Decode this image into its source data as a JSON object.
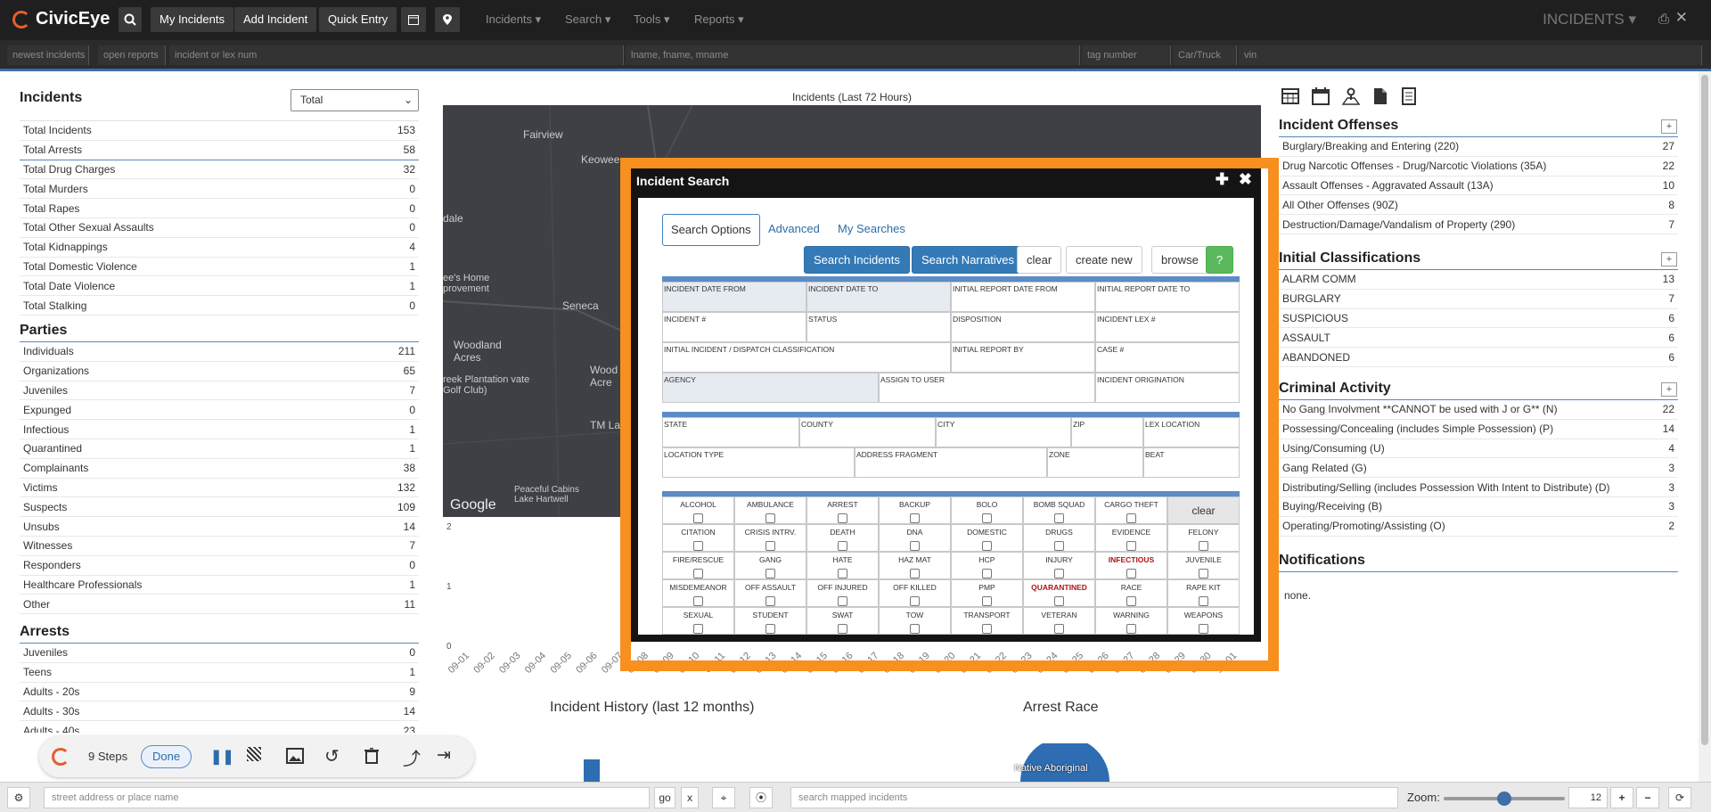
{
  "app": {
    "logo": "CivicEye",
    "nav_buttons": [
      "My Incidents",
      "Add Incident",
      "Quick Entry"
    ],
    "menus": [
      "Incidents",
      "Search",
      "Tools",
      "Reports"
    ],
    "page_title": "INCIDENTS"
  },
  "searchbar": {
    "newest": "newest incidents",
    "open": "open reports",
    "incident_placeholder": "incident or lex num",
    "name_placeholder": "lname, fname, mname",
    "tag_placeholder": "tag number",
    "car_placeholder": "Car/Truck",
    "vin_placeholder": "vin"
  },
  "incidents": {
    "title": "Incidents",
    "select": "Total",
    "rows": [
      {
        "label": "Total Incidents",
        "value": "153"
      },
      {
        "label": "Total Arrests",
        "value": "58"
      },
      {
        "label": "Total Drug Charges",
        "value": "32"
      },
      {
        "label": "Total Murders",
        "value": "0"
      },
      {
        "label": "Total Rapes",
        "value": "0"
      },
      {
        "label": "Total Other Sexual Assaults",
        "value": "0"
      },
      {
        "label": "Total Kidnappings",
        "value": "4"
      },
      {
        "label": "Total Domestic Violence",
        "value": "1"
      },
      {
        "label": "Total Date Violence",
        "value": "1"
      },
      {
        "label": "Total Stalking",
        "value": "0"
      }
    ]
  },
  "parties": {
    "title": "Parties",
    "rows": [
      {
        "label": "Individuals",
        "value": "211"
      },
      {
        "label": "Organizations",
        "value": "65"
      },
      {
        "label": "Juveniles",
        "value": "7"
      },
      {
        "label": "Expunged",
        "value": "0"
      },
      {
        "label": "Infectious",
        "value": "1"
      },
      {
        "label": "Quarantined",
        "value": "1"
      },
      {
        "label": "Complainants",
        "value": "38"
      },
      {
        "label": "Victims",
        "value": "132"
      },
      {
        "label": "Suspects",
        "value": "109"
      },
      {
        "label": "Unsubs",
        "value": "14"
      },
      {
        "label": "Witnesses",
        "value": "7"
      },
      {
        "label": "Responders",
        "value": "0"
      },
      {
        "label": "Healthcare Professionals",
        "value": "1"
      },
      {
        "label": "Other",
        "value": "11"
      }
    ]
  },
  "arrests": {
    "title": "Arrests",
    "rows": [
      {
        "label": "Juveniles",
        "value": "0"
      },
      {
        "label": "Teens",
        "value": "1"
      },
      {
        "label": "Adults - 20s",
        "value": "9"
      },
      {
        "label": "Adults - 30s",
        "value": "14"
      },
      {
        "label": "Adults - 40s",
        "value": "23"
      }
    ]
  },
  "map": {
    "title": "Incidents (Last 72 Hours)",
    "labels": [
      "Fairview",
      "Keowee",
      "dale",
      "ee's Home provement",
      "Seneca",
      "Woodland Acres",
      "reek Plantation vate Golf Club)",
      "Wood Acre",
      "TM La",
      "Peaceful Cabins Lake Hartwell"
    ],
    "google": "Google"
  },
  "chart_data": {
    "type": "bar",
    "categories": [
      "09-01",
      "09-02",
      "09-03",
      "09-04",
      "09-05",
      "09-06",
      "09-07",
      "09-08",
      "09-09",
      "09-10",
      "09-11",
      "09-12",
      "09-13",
      "09-14",
      "09-15",
      "09-16",
      "09-17",
      "09-18",
      "09-19",
      "09-20",
      "09-21",
      "09-22",
      "09-23",
      "09-24",
      "09-25",
      "09-26",
      "09-27",
      "09-28",
      "09-29",
      "09-30",
      "10-01"
    ],
    "ylim": [
      0,
      2
    ],
    "yticks": [
      "2",
      "1",
      "0"
    ],
    "title": "",
    "xlabel": "",
    "ylabel": ""
  },
  "history": {
    "title": "Incident History (last 12 months)"
  },
  "race": {
    "title": "Arrest Race",
    "slice_label": "Native Aboriginal"
  },
  "right": {
    "icons": [
      "table-icon",
      "calendar-icon",
      "map-icon",
      "document-icon",
      "book-icon"
    ],
    "offenses": {
      "title": "Incident Offenses",
      "rows": [
        {
          "label": "Burglary/Breaking and Entering (220)",
          "value": "27"
        },
        {
          "label": "Drug Narcotic Offenses - Drug/Narcotic Violations (35A)",
          "value": "22"
        },
        {
          "label": "Assault Offenses - Aggravated Assault (13A)",
          "value": "10"
        },
        {
          "label": "All Other Offenses (90Z)",
          "value": "8"
        },
        {
          "label": "Destruction/Damage/Vandalism of Property (290)",
          "value": "7"
        }
      ]
    },
    "classifications": {
      "title": "Initial Classifications",
      "rows": [
        {
          "label": "ALARM COMM",
          "value": "13"
        },
        {
          "label": "BURGLARY",
          "value": "7"
        },
        {
          "label": "SUSPICIOUS",
          "value": "6"
        },
        {
          "label": "ASSAULT",
          "value": "6"
        },
        {
          "label": "ABANDONED",
          "value": "6"
        }
      ]
    },
    "criminal": {
      "title": "Criminal Activity",
      "rows": [
        {
          "label": "No Gang Involvment **CANNOT be used with J or G** (N)",
          "value": "22"
        },
        {
          "label": "Possessing/Concealing (includes Simple Possession) (P)",
          "value": "14"
        },
        {
          "label": "Using/Consuming (U)",
          "value": "4"
        },
        {
          "label": "Gang Related (G)",
          "value": "3"
        },
        {
          "label": "Distributing/Selling (includes Possession With Intent to Distribute) (D)",
          "value": "3"
        },
        {
          "label": "Buying/Receiving (B)",
          "value": "3"
        },
        {
          "label": "Operating/Promoting/Assisting (O)",
          "value": "2"
        }
      ]
    },
    "notifications": {
      "title": "Notifications",
      "text": "none."
    }
  },
  "modal": {
    "title": "Incident Search",
    "tabs": [
      "Search Options",
      "Advanced",
      "My Searches"
    ],
    "buttons": {
      "search_incidents": "Search Incidents",
      "search_narratives": "Search Narratives",
      "clear": "clear",
      "create_new": "create new",
      "browse": "browse",
      "help": "?"
    },
    "fields1": [
      "INCIDENT DATE FROM",
      "INCIDENT DATE TO",
      "INITIAL REPORT DATE FROM",
      "INITIAL REPORT DATE TO",
      "INCIDENT #",
      "STATUS",
      "DISPOSITION",
      "INCIDENT LEX #",
      "INITIAL INCIDENT / DISPATCH CLASSIFICATION",
      "INITIAL REPORT BY",
      "CASE #",
      "AGENCY",
      "ASSIGN TO USER",
      "INCIDENT ORIGINATION"
    ],
    "fields2": [
      "STATE",
      "COUNTY",
      "CITY",
      "ZIP",
      "LEX LOCATION",
      "LOCATION TYPE",
      "ADDRESS FRAGMENT",
      "ZONE",
      "BEAT"
    ],
    "flags_clear": "clear",
    "flags": [
      "ALCOHOL",
      "AMBULANCE",
      "ARREST",
      "BACKUP",
      "BOLO",
      "BOMB SQUAD",
      "CARGO THEFT",
      "CITATION",
      "CRISIS INTRV.",
      "DEATH",
      "DNA",
      "DOMESTIC",
      "DRUGS",
      "EVIDENCE",
      "FELONY",
      "FIRE/RESCUE",
      "GANG",
      "HATE",
      "HAZ MAT",
      "HCP",
      "INJURY",
      "INFECTIOUS",
      "JUVENILE",
      "MISDEMEANOR",
      "OFF ASSAULT",
      "OFF INJURED",
      "OFF KILLED",
      "PMP",
      "QUARANTINED",
      "RACE",
      "RAPE KIT",
      "SEXUAL",
      "STUDENT",
      "SWAT",
      "TOW",
      "TRANSPORT",
      "VETERAN",
      "WARNING",
      "WEAPONS"
    ]
  },
  "recorder": {
    "steps": "9 Steps",
    "done": "Done"
  },
  "bottom": {
    "address_placeholder": "street address or place name",
    "go": "go",
    "x": "x",
    "mapped_placeholder": "search mapped incidents",
    "zoom_label": "Zoom:",
    "zoom_value": "12",
    "zoom_level": 0.5
  }
}
